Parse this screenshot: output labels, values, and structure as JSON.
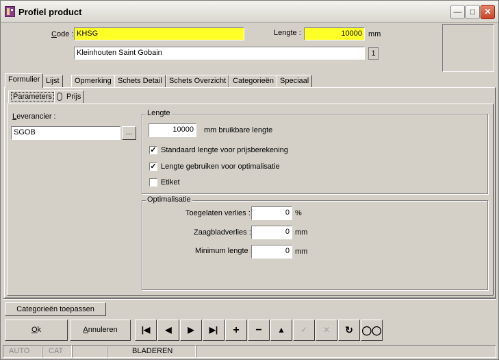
{
  "window": {
    "title": "Profiel product"
  },
  "header": {
    "code_label": "Code :",
    "code_value": "KHSG",
    "lengte_label": "Lengte :",
    "lengte_value": "10000",
    "lengte_unit": "mm",
    "description_value": "Kleinhouten Saint Gobain",
    "badge_value": "1"
  },
  "tabs": [
    "Formulier",
    "Lijst",
    "Opmerking",
    "Schets Detail",
    "Schets Overzicht",
    "Categorieën",
    "Speciaal"
  ],
  "subtabs": [
    "Parameters",
    "Prijs"
  ],
  "leverancier": {
    "label": "Leverancier :",
    "value": "SGOB",
    "browse_label": "..."
  },
  "lengte_group": {
    "title": "Lengte",
    "value": "10000",
    "value_label": "mm bruikbare lengte",
    "options": [
      {
        "label": "Standaard lengte voor prijsberekening",
        "checked": true
      },
      {
        "label": "Lengte gebruiken voor optimalisatie",
        "checked": true
      },
      {
        "label": "Etiket",
        "checked": false
      }
    ]
  },
  "optimalisatie_group": {
    "title": "Optimalisatie",
    "rows": [
      {
        "label": "Toegelaten verlies :",
        "value": "0",
        "unit": "%"
      },
      {
        "label": "Zaagbladverlies :",
        "value": "0",
        "unit": "mm"
      },
      {
        "label": "Minimum lengte :",
        "value": "0",
        "unit": "mm"
      }
    ]
  },
  "buttons": {
    "categorieen_toepassen": "Categorieën toepassen",
    "ok": "Ok",
    "annuleren": "Annuleren"
  },
  "nav_icons": [
    "first-record-icon",
    "previous-record-icon",
    "next-record-icon",
    "last-record-icon",
    "add-record-icon",
    "delete-record-icon",
    "up-icon",
    "confirm-icon",
    "cancel-icon",
    "refresh-icon",
    "binoculars-icon"
  ],
  "status": {
    "auto": "AUTO",
    "cat": "CAT",
    "mode": "BLADEREN"
  }
}
